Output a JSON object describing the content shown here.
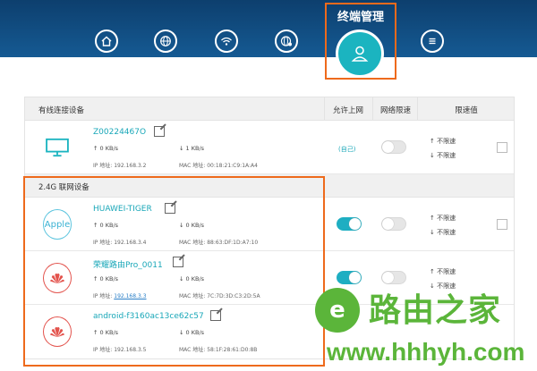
{
  "nav": {
    "active_title": "终端管理",
    "icons": [
      "home-icon",
      "globe-icon",
      "wifi-icon",
      "globe-settings-icon",
      "user-icon",
      "menu-icon"
    ]
  },
  "wired": {
    "section_title": "有线连接设备",
    "col_access": "允许上网",
    "col_limit": "网络限速",
    "col_value": "限速值",
    "devices": [
      {
        "name": "Z00224467O",
        "up": "0 KB/s",
        "down": "1 KB/s",
        "ip": "IP 地址: 192.168.3.2",
        "mac": "MAC 地址: 00:18:21:C9:1A:A4",
        "access": "(自己)",
        "limit_up": "不限速",
        "limit_down": "不限速"
      }
    ]
  },
  "wireless": {
    "section_title": "2.4G 联网设备",
    "devices": [
      {
        "name": "HUAWEI-TIGER",
        "icon_text": "Apple",
        "up": "0 KB/s",
        "down": "0 KB/s",
        "ip": "IP 地址: 192.168.3.4",
        "mac": "MAC 地址: 88:63:DF:1D:A7:10",
        "limit_up": "不限速",
        "limit_down": "不限速"
      },
      {
        "name": "荣耀路由Pro_0011",
        "up": "0 KB/s",
        "down": "0 KB/s",
        "ip_label": "IP 地址:",
        "ip_value": "192.168.3.3",
        "mac": "MAC 地址: 7C:7D:3D:C3:2D:5A",
        "limit_up": "不限速",
        "limit_down": "不限速"
      },
      {
        "name": "android-f3160ac13ce62c57",
        "up": "0 KB/s",
        "down": "0 KB/s",
        "ip": "IP 地址: 192.168.3.5",
        "mac": "MAC 地址: 58:1F:28:61:D0:8B"
      }
    ]
  },
  "watermark": {
    "glyph": "e",
    "text": "路由之家",
    "url": "www.hhhyh.com"
  },
  "colors": {
    "header": "#155a93",
    "accent": "#1bb4c0",
    "highlight": "#ee6a1c",
    "watermark": "#5bb53a"
  }
}
